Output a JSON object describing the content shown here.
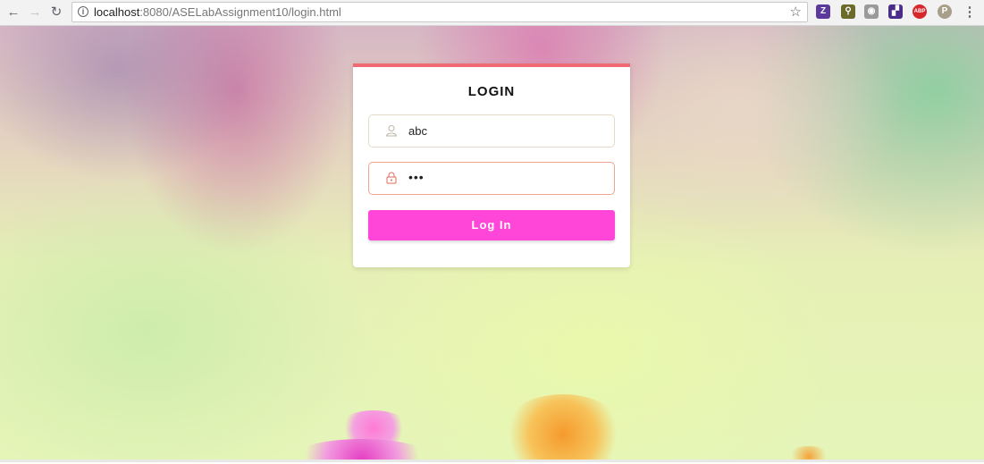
{
  "browser": {
    "url_host": "localhost",
    "url_path": ":8080/ASELabAssignment10/login.html"
  },
  "icons": {
    "back": "back-arrow-icon",
    "forward": "forward-arrow-icon",
    "reload": "reload-icon",
    "info": "info-icon",
    "star": "star-icon",
    "user": "user-icon",
    "lock": "lock-icon",
    "menu": "menu-dots-icon"
  },
  "extensions": [
    {
      "name": "extension-z-icon",
      "glyph": "Z",
      "color": "#5b3a9b"
    },
    {
      "name": "extension-keep-icon",
      "glyph": "⚲",
      "color": "#6b6b2a"
    },
    {
      "name": "extension-camera-icon",
      "glyph": "◉",
      "color": "#9a9a9a"
    },
    {
      "name": "extension-graph-icon",
      "glyph": "▞",
      "color": "#4b2c88"
    },
    {
      "name": "extension-abp-icon",
      "glyph": "ABP",
      "color": "#d7262c"
    },
    {
      "name": "extension-p-icon",
      "glyph": "P",
      "color": "#a89f8a"
    }
  ],
  "login": {
    "title": "LOGIN",
    "username_value": "abc",
    "password_value": "•••",
    "button_label": "Log In"
  },
  "colors": {
    "accent": "#f06a73",
    "button": "#ff46d9"
  }
}
